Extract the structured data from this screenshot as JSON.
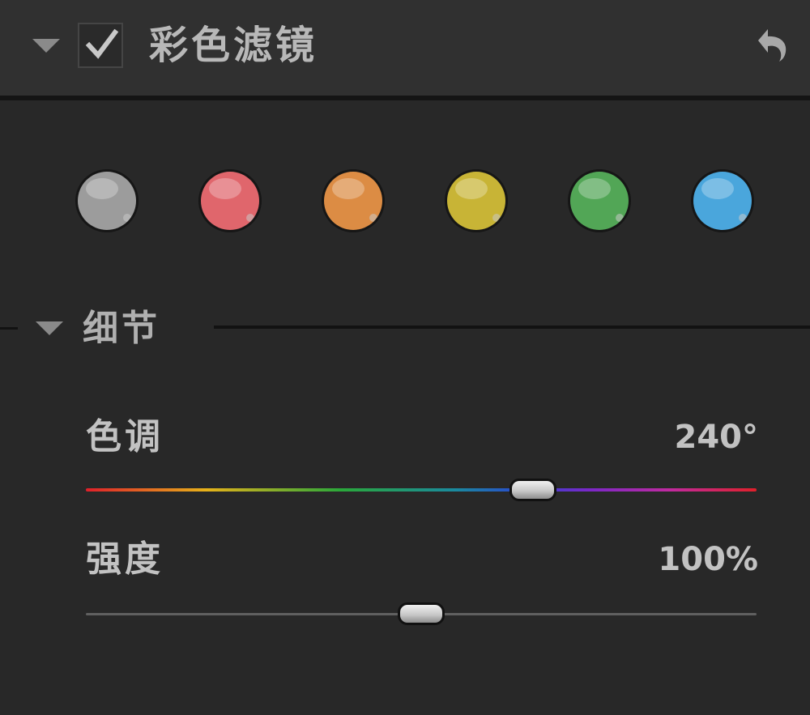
{
  "header": {
    "title": "彩色滤镜",
    "enabled": true
  },
  "swatches": [
    {
      "name": "gray",
      "color": "#9c9c9c"
    },
    {
      "name": "red",
      "color": "#e0666c"
    },
    {
      "name": "orange",
      "color": "#dc8c44"
    },
    {
      "name": "yellow",
      "color": "#c8b436"
    },
    {
      "name": "green",
      "color": "#52a656"
    },
    {
      "name": "blue",
      "color": "#4aa6dc"
    }
  ],
  "details": {
    "title": "细节",
    "hue": {
      "label": "色调",
      "value_text": "240°",
      "value": 240,
      "min": 0,
      "max": 360
    },
    "intensity": {
      "label": "强度",
      "value_text": "100%",
      "value": 100,
      "min": 0,
      "max": 200
    }
  }
}
